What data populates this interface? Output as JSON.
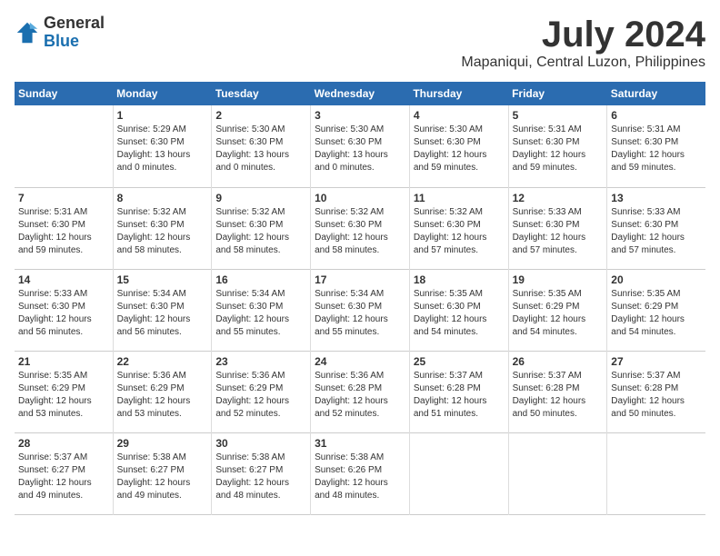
{
  "logo": {
    "general": "General",
    "blue": "Blue"
  },
  "title": "July 2024",
  "location": "Mapaniqui, Central Luzon, Philippines",
  "days_of_week": [
    "Sunday",
    "Monday",
    "Tuesday",
    "Wednesday",
    "Thursday",
    "Friday",
    "Saturday"
  ],
  "weeks": [
    [
      {
        "day": "",
        "detail": ""
      },
      {
        "day": "1",
        "detail": "Sunrise: 5:29 AM\nSunset: 6:30 PM\nDaylight: 13 hours\nand 0 minutes."
      },
      {
        "day": "2",
        "detail": "Sunrise: 5:30 AM\nSunset: 6:30 PM\nDaylight: 13 hours\nand 0 minutes."
      },
      {
        "day": "3",
        "detail": "Sunrise: 5:30 AM\nSunset: 6:30 PM\nDaylight: 13 hours\nand 0 minutes."
      },
      {
        "day": "4",
        "detail": "Sunrise: 5:30 AM\nSunset: 6:30 PM\nDaylight: 12 hours\nand 59 minutes."
      },
      {
        "day": "5",
        "detail": "Sunrise: 5:31 AM\nSunset: 6:30 PM\nDaylight: 12 hours\nand 59 minutes."
      },
      {
        "day": "6",
        "detail": "Sunrise: 5:31 AM\nSunset: 6:30 PM\nDaylight: 12 hours\nand 59 minutes."
      }
    ],
    [
      {
        "day": "7",
        "detail": "Sunrise: 5:31 AM\nSunset: 6:30 PM\nDaylight: 12 hours\nand 59 minutes."
      },
      {
        "day": "8",
        "detail": "Sunrise: 5:32 AM\nSunset: 6:30 PM\nDaylight: 12 hours\nand 58 minutes."
      },
      {
        "day": "9",
        "detail": "Sunrise: 5:32 AM\nSunset: 6:30 PM\nDaylight: 12 hours\nand 58 minutes."
      },
      {
        "day": "10",
        "detail": "Sunrise: 5:32 AM\nSunset: 6:30 PM\nDaylight: 12 hours\nand 58 minutes."
      },
      {
        "day": "11",
        "detail": "Sunrise: 5:32 AM\nSunset: 6:30 PM\nDaylight: 12 hours\nand 57 minutes."
      },
      {
        "day": "12",
        "detail": "Sunrise: 5:33 AM\nSunset: 6:30 PM\nDaylight: 12 hours\nand 57 minutes."
      },
      {
        "day": "13",
        "detail": "Sunrise: 5:33 AM\nSunset: 6:30 PM\nDaylight: 12 hours\nand 57 minutes."
      }
    ],
    [
      {
        "day": "14",
        "detail": "Sunrise: 5:33 AM\nSunset: 6:30 PM\nDaylight: 12 hours\nand 56 minutes."
      },
      {
        "day": "15",
        "detail": "Sunrise: 5:34 AM\nSunset: 6:30 PM\nDaylight: 12 hours\nand 56 minutes."
      },
      {
        "day": "16",
        "detail": "Sunrise: 5:34 AM\nSunset: 6:30 PM\nDaylight: 12 hours\nand 55 minutes."
      },
      {
        "day": "17",
        "detail": "Sunrise: 5:34 AM\nSunset: 6:30 PM\nDaylight: 12 hours\nand 55 minutes."
      },
      {
        "day": "18",
        "detail": "Sunrise: 5:35 AM\nSunset: 6:30 PM\nDaylight: 12 hours\nand 54 minutes."
      },
      {
        "day": "19",
        "detail": "Sunrise: 5:35 AM\nSunset: 6:29 PM\nDaylight: 12 hours\nand 54 minutes."
      },
      {
        "day": "20",
        "detail": "Sunrise: 5:35 AM\nSunset: 6:29 PM\nDaylight: 12 hours\nand 54 minutes."
      }
    ],
    [
      {
        "day": "21",
        "detail": "Sunrise: 5:35 AM\nSunset: 6:29 PM\nDaylight: 12 hours\nand 53 minutes."
      },
      {
        "day": "22",
        "detail": "Sunrise: 5:36 AM\nSunset: 6:29 PM\nDaylight: 12 hours\nand 53 minutes."
      },
      {
        "day": "23",
        "detail": "Sunrise: 5:36 AM\nSunset: 6:29 PM\nDaylight: 12 hours\nand 52 minutes."
      },
      {
        "day": "24",
        "detail": "Sunrise: 5:36 AM\nSunset: 6:28 PM\nDaylight: 12 hours\nand 52 minutes."
      },
      {
        "day": "25",
        "detail": "Sunrise: 5:37 AM\nSunset: 6:28 PM\nDaylight: 12 hours\nand 51 minutes."
      },
      {
        "day": "26",
        "detail": "Sunrise: 5:37 AM\nSunset: 6:28 PM\nDaylight: 12 hours\nand 50 minutes."
      },
      {
        "day": "27",
        "detail": "Sunrise: 5:37 AM\nSunset: 6:28 PM\nDaylight: 12 hours\nand 50 minutes."
      }
    ],
    [
      {
        "day": "28",
        "detail": "Sunrise: 5:37 AM\nSunset: 6:27 PM\nDaylight: 12 hours\nand 49 minutes."
      },
      {
        "day": "29",
        "detail": "Sunrise: 5:38 AM\nSunset: 6:27 PM\nDaylight: 12 hours\nand 49 minutes."
      },
      {
        "day": "30",
        "detail": "Sunrise: 5:38 AM\nSunset: 6:27 PM\nDaylight: 12 hours\nand 48 minutes."
      },
      {
        "day": "31",
        "detail": "Sunrise: 5:38 AM\nSunset: 6:26 PM\nDaylight: 12 hours\nand 48 minutes."
      },
      {
        "day": "",
        "detail": ""
      },
      {
        "day": "",
        "detail": ""
      },
      {
        "day": "",
        "detail": ""
      }
    ]
  ]
}
